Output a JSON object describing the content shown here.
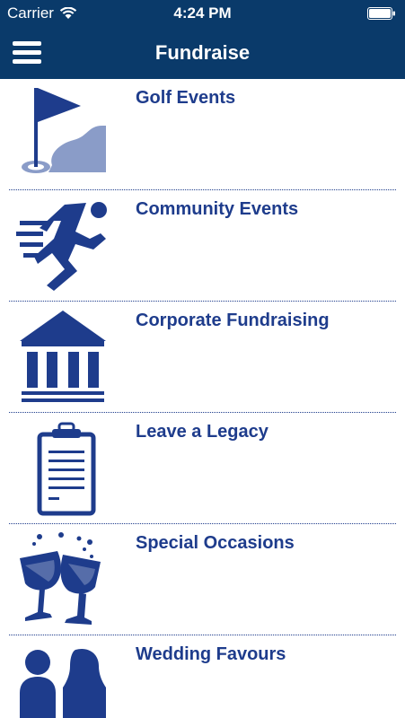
{
  "status_bar": {
    "carrier": "Carrier",
    "time": "4:24 PM"
  },
  "nav": {
    "title": "Fundraise",
    "menu_icon": "hamburger-menu-icon"
  },
  "items": [
    {
      "label": "Golf Events",
      "icon": "golf-flag-icon"
    },
    {
      "label": "Community Events",
      "icon": "runner-icon"
    },
    {
      "label": "Corporate Fundraising",
      "icon": "bank-building-icon"
    },
    {
      "label": "Leave a Legacy",
      "icon": "clipboard-icon"
    },
    {
      "label": "Special Occasions",
      "icon": "wine-glasses-icon"
    },
    {
      "label": "Wedding Favours",
      "icon": "couple-icon"
    }
  ],
  "colors": {
    "header": "#0a3a6a",
    "text": "#1e3c8c",
    "icon": "#1e3c8c",
    "icon_light": "#8a9cc8"
  }
}
